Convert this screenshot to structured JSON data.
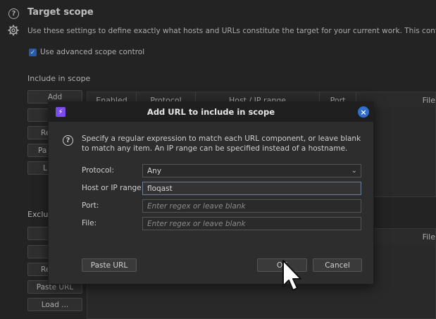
{
  "header": {
    "title": "Target scope",
    "description": "Use these settings to define exactly what hosts and URLs constitute the target for your current work. This configuration aff",
    "help_icon": "question-icon",
    "settings_icon": "gear-icon"
  },
  "advanced_scope": {
    "label": "Use advanced scope control",
    "checked": true
  },
  "include": {
    "label": "Include in scope",
    "buttons": [
      "Add",
      "",
      "Re",
      "Pa",
      "L"
    ],
    "columns": [
      "Enabled",
      "Protocol",
      "Host / IP range",
      "Port",
      "File"
    ]
  },
  "exclude": {
    "label": "Exclu",
    "buttons": [
      "",
      "",
      "Re",
      "Paste URL",
      "Load ..."
    ],
    "columns": [
      "File"
    ]
  },
  "dialog": {
    "title": "Add URL to include in scope",
    "help": "Specify a regular expression to match each URL component, or leave blank to match any item. An IP range can be specified instead of a hostname.",
    "protocol_label": "Protocol:",
    "protocol_value": "Any",
    "host_label": "Host or IP range:",
    "host_value": "floqast",
    "port_label": "Port:",
    "port_placeholder": "Enter regex or leave blank",
    "file_label": "File:",
    "file_placeholder": "Enter regex or leave blank",
    "paste_url": "Paste URL",
    "ok": "OK",
    "cancel": "Cancel"
  },
  "colors": {
    "accent": "#2f6fd1",
    "app_icon": "#7b4de8"
  }
}
